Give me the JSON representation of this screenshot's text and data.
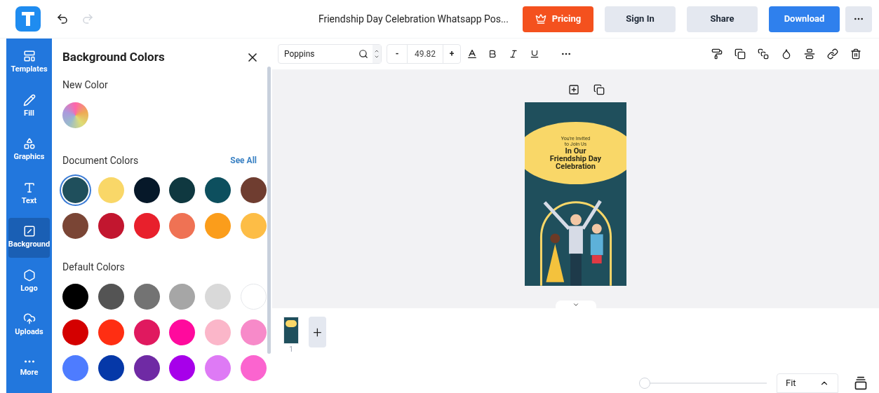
{
  "header": {
    "title": "Friendship Day Celebration Whatsapp Pos...",
    "buttons": [
      {
        "label": "Pricing",
        "kind": "pricing"
      },
      {
        "label": "Sign In",
        "kind": "plain"
      },
      {
        "label": "Share",
        "kind": "plain"
      },
      {
        "label": "Download",
        "kind": "primary"
      }
    ]
  },
  "sidebar": {
    "items": [
      {
        "label": "Templates",
        "selected": false
      },
      {
        "label": "Fill",
        "selected": false
      },
      {
        "label": "Graphics",
        "selected": false
      },
      {
        "label": "Text",
        "selected": false
      },
      {
        "label": "Background",
        "selected": true
      },
      {
        "label": "Logo",
        "selected": false
      },
      {
        "label": "Uploads",
        "selected": false
      },
      {
        "label": "More",
        "selected": false
      }
    ]
  },
  "panel": {
    "title": "Background Colors",
    "new_color_label": "New Color",
    "document_colors_label": "Document Colors",
    "see_all": "See All",
    "document_colors": [
      {
        "color": "#1f4f5c",
        "selected": true
      },
      {
        "color": "#f9d768",
        "selected": false
      },
      {
        "color": "#061829",
        "selected": false
      },
      {
        "color": "#0f3840",
        "selected": false
      },
      {
        "color": "#0d4f5e",
        "selected": false
      },
      {
        "color": "#6f3d30",
        "selected": false
      },
      {
        "color": "#7a4535",
        "selected": false
      },
      {
        "color": "#c2162f",
        "selected": false
      },
      {
        "color": "#e8202c",
        "selected": false
      },
      {
        "color": "#ef7254",
        "selected": false
      },
      {
        "color": "#fb9d1b",
        "selected": false
      },
      {
        "color": "#fdbd46",
        "selected": false
      }
    ],
    "default_colors_label": "Default Colors",
    "default_colors": [
      {
        "color": "#000000"
      },
      {
        "color": "#545454"
      },
      {
        "color": "#737373"
      },
      {
        "color": "#a6a6a6"
      },
      {
        "color": "#d9d9d9"
      },
      {
        "color": "#ffffff"
      },
      {
        "color": "#d40000"
      },
      {
        "color": "#ff2e12"
      },
      {
        "color": "#e0195f"
      },
      {
        "color": "#ff0a9d"
      },
      {
        "color": "#fbb6c9"
      },
      {
        "color": "#f78ac9"
      },
      {
        "color": "#4e7cff"
      },
      {
        "color": "#0538a8"
      },
      {
        "color": "#6f2aa4"
      },
      {
        "color": "#a700ea"
      },
      {
        "color": "#de7af5"
      },
      {
        "color": "#fb64cf"
      }
    ]
  },
  "toolbar": {
    "font": "Poppins",
    "font_size": "49.82",
    "minus": "-",
    "plus": "+"
  },
  "poster": {
    "lines": [
      "You're Invited",
      "to Join Us",
      "In Our",
      "Friendship Day",
      "Celebration"
    ]
  },
  "pages": {
    "thumb_number": "1",
    "add": "+"
  },
  "zoom": {
    "level": 0,
    "fit": "Fit"
  }
}
